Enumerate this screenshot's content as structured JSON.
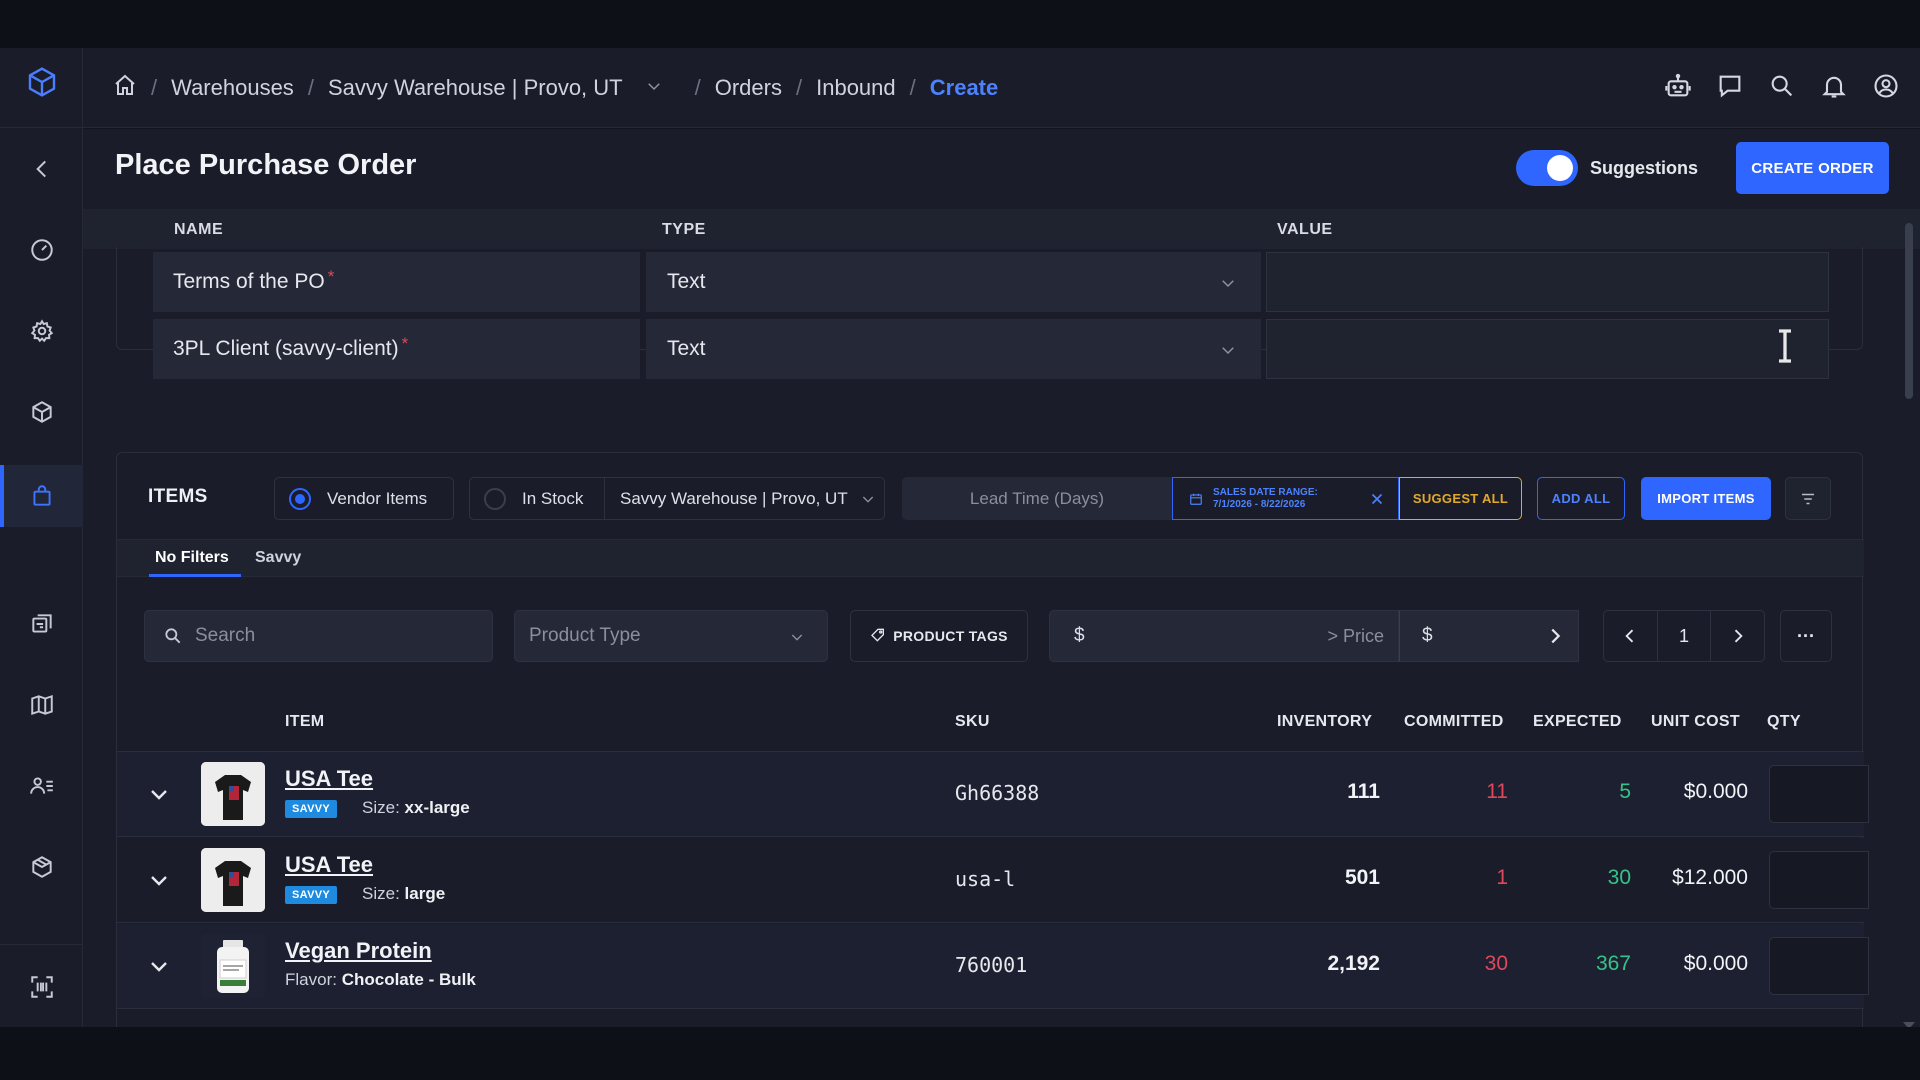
{
  "breadcrumbs": {
    "items": [
      "Warehouses",
      "Savvy Warehouse | Provo, UT",
      "Orders",
      "Inbound"
    ],
    "current": "Create"
  },
  "page": {
    "title": "Place Purchase Order",
    "suggestions_label": "Suggestions",
    "suggestions_on": true,
    "create_order_label": "CREATE ORDER"
  },
  "custom_fields": {
    "headers": {
      "name": "NAME",
      "type": "TYPE",
      "value": "VALUE"
    },
    "rows": [
      {
        "name": "Terms of the PO",
        "required_mark": "*",
        "type": "Text",
        "value": ""
      },
      {
        "name": "3PL Client (savvy-client)",
        "required_mark": "*",
        "type": "Text",
        "value": ""
      }
    ]
  },
  "items": {
    "label": "ITEMS",
    "vendor_items_label": "Vendor Items",
    "in_stock_label": "In Stock",
    "warehouse": "Savvy Warehouse | Provo, UT",
    "lead_time_placeholder": "Lead Time (Days)",
    "sales_date_label": "SALES DATE RANGE:",
    "sales_date_value": "7/1/2026 - 8/22/2026",
    "suggest_all_label": "SUGGEST ALL",
    "add_all_label": "ADD ALL",
    "import_items_label": "IMPORT ITEMS",
    "tabs": [
      "No Filters",
      "Savvy"
    ],
    "search_placeholder": "Search",
    "product_type_placeholder": "Product Type",
    "product_tags_label": "PRODUCT TAGS",
    "currency": "$",
    "price_label": "> Price",
    "page_number": "1",
    "more_label": "···",
    "columns": {
      "item": "ITEM",
      "sku": "SKU",
      "inventory": "INVENTORY",
      "committed": "COMMITTED",
      "expected": "EXPECTED",
      "unit_cost": "UNIT COST",
      "qty": "QTY"
    },
    "rows": [
      {
        "name": "USA Tee",
        "tag": "SAVVY",
        "attr_label": "Size:",
        "attr_value": "xx-large",
        "sku": "Gh66388",
        "inventory": "111",
        "committed": "11",
        "expected": "5",
        "unit_cost": "$0.000"
      },
      {
        "name": "USA Tee",
        "tag": "SAVVY",
        "attr_label": "Size:",
        "attr_value": "large",
        "sku": "usa-l",
        "inventory": "501",
        "committed": "1",
        "expected": "30",
        "unit_cost": "$12.000"
      },
      {
        "name": "Vegan Protein",
        "tag": "",
        "attr_label": "Flavor:",
        "attr_value": "Chocolate - Bulk",
        "sku": "760001",
        "inventory": "2,192",
        "committed": "30",
        "expected": "367",
        "unit_cost": "$0.000"
      }
    ]
  },
  "colors": {
    "accent": "#2f66ff",
    "warning": "#e3a92b",
    "negative": "#e2465b",
    "positive": "#37c28a",
    "tag": "#1e8ae0"
  }
}
